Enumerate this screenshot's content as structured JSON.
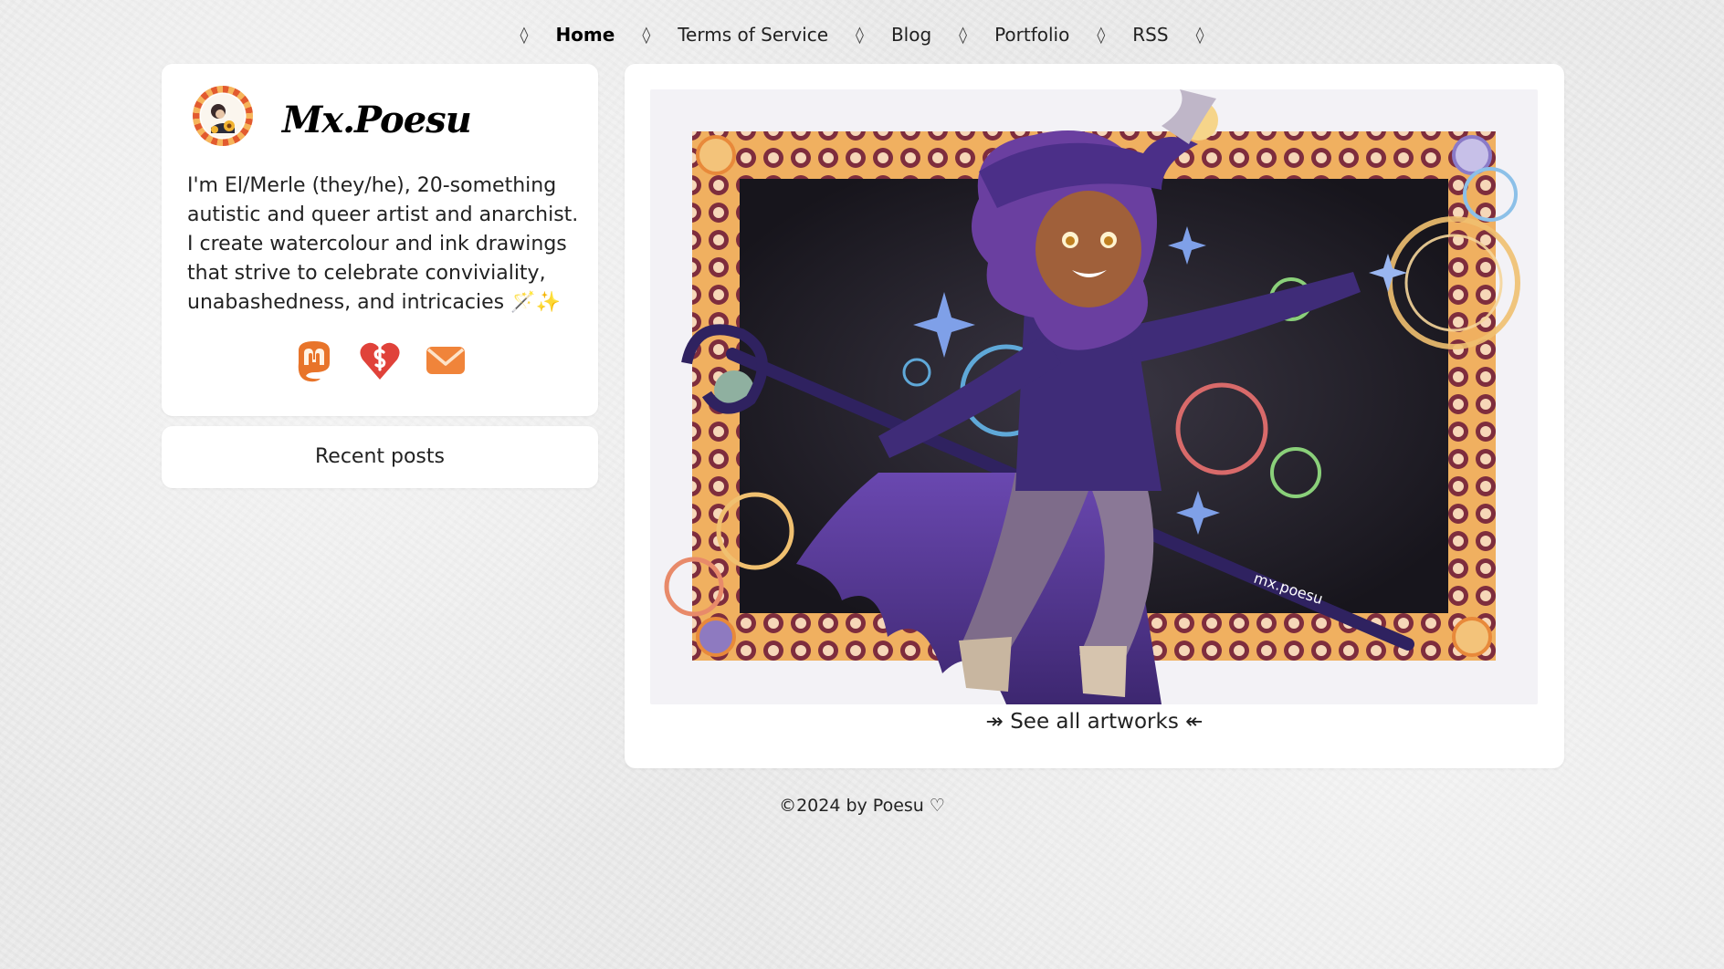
{
  "nav": {
    "separator": "◊",
    "items": [
      {
        "label": "Home",
        "active": true
      },
      {
        "label": "Terms of Service",
        "active": false
      },
      {
        "label": "Blog",
        "active": false
      },
      {
        "label": "Portfolio",
        "active": false
      },
      {
        "label": "RSS",
        "active": false
      }
    ]
  },
  "profile": {
    "title": "Mx.Poesu",
    "bio": "I'm El/Merle (they/he), 20-something autistic and queer artist and anarchist. I create watercolour and ink drawings that strive to celebrate conviviality, unabashedness, and intricacies 🪄✨",
    "socials": [
      {
        "icon": "mastodon-icon"
      },
      {
        "icon": "donation-icon"
      },
      {
        "icon": "email-icon"
      }
    ]
  },
  "recent_posts": {
    "label": "Recent posts"
  },
  "artwork": {
    "signature": "mx.poesu",
    "see_all": "↠ See all artworks ↞"
  },
  "footer": {
    "text": "©2024 by Poesu ♡"
  },
  "colors": {
    "background": "#ececec",
    "card": "#ffffff",
    "accent_orange": "#e8742a",
    "art_purple": "#4b2a7a",
    "frame_orange": "#e89a3a",
    "frame_maroon": "#7a2b3a"
  }
}
